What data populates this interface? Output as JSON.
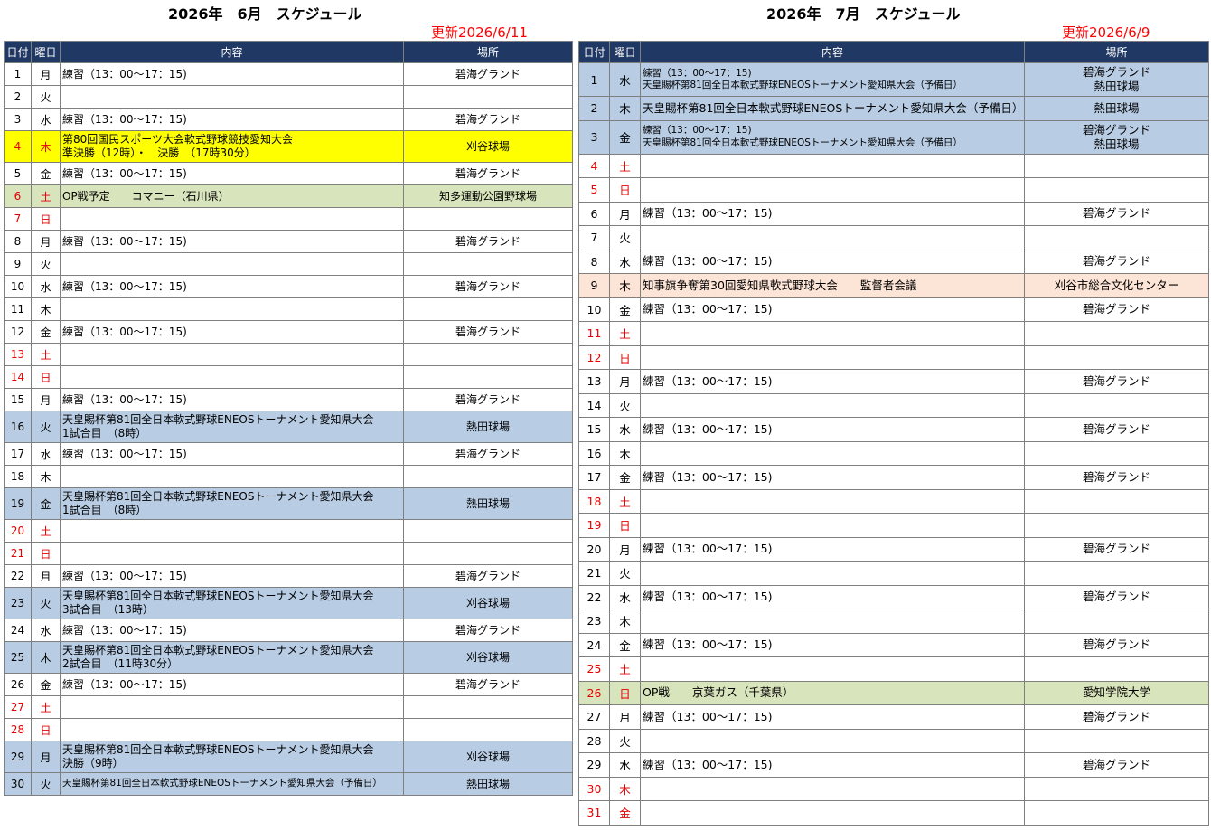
{
  "june": {
    "title": "2026年　6月　スケジュール",
    "updated": "更新2026/6/11",
    "headers": {
      "day": "日付",
      "weekday": "曜日",
      "content": "内容",
      "place": "場所"
    },
    "rows": [
      {
        "day": "1",
        "wd": "月",
        "content": [
          "練習（13：00～17：15)"
        ],
        "place": [
          "碧海グランド"
        ]
      },
      {
        "day": "2",
        "wd": "火",
        "content": [],
        "place": []
      },
      {
        "day": "3",
        "wd": "水",
        "content": [
          "練習（13：00～17：15)"
        ],
        "place": [
          "碧海グランド"
        ]
      },
      {
        "day": "4",
        "wd": "木",
        "content": [
          "第80回国民スポーツ大会軟式野球競技愛知大会",
          "準決勝（12時）・　決勝　（17時30分）"
        ],
        "place": [
          "刈谷球場"
        ],
        "bg": "yellow",
        "red": true
      },
      {
        "day": "5",
        "wd": "金",
        "content": [
          "練習（13：00～17：15)"
        ],
        "place": [
          "碧海グランド"
        ]
      },
      {
        "day": "6",
        "wd": "土",
        "content": [
          "OP戦予定　　コマニー（石川県）"
        ],
        "place": [
          "知多運動公園野球場"
        ],
        "bg": "green",
        "red": true
      },
      {
        "day": "7",
        "wd": "日",
        "content": [],
        "place": [],
        "red": true
      },
      {
        "day": "8",
        "wd": "月",
        "content": [
          "練習（13：00～17：15)"
        ],
        "place": [
          "碧海グランド"
        ]
      },
      {
        "day": "9",
        "wd": "火",
        "content": [],
        "place": []
      },
      {
        "day": "10",
        "wd": "水",
        "content": [
          "練習（13：00～17：15)"
        ],
        "place": [
          "碧海グランド"
        ]
      },
      {
        "day": "11",
        "wd": "木",
        "content": [],
        "place": []
      },
      {
        "day": "12",
        "wd": "金",
        "content": [
          "練習（13：00～17：15)"
        ],
        "place": [
          "碧海グランド"
        ]
      },
      {
        "day": "13",
        "wd": "土",
        "content": [],
        "place": [],
        "red": true
      },
      {
        "day": "14",
        "wd": "日",
        "content": [],
        "place": [],
        "red": true
      },
      {
        "day": "15",
        "wd": "月",
        "content": [
          "練習（13：00～17：15)"
        ],
        "place": [
          "碧海グランド"
        ]
      },
      {
        "day": "16",
        "wd": "火",
        "content": [
          "天皇賜杯第81回全日本軟式野球ENEOSトーナメント愛知県大会",
          "1試合目　（8時）"
        ],
        "place": [
          "熱田球場"
        ],
        "bg": "blue"
      },
      {
        "day": "17",
        "wd": "水",
        "content": [
          "練習（13：00～17：15)"
        ],
        "place": [
          "碧海グランド"
        ]
      },
      {
        "day": "18",
        "wd": "木",
        "content": [],
        "place": []
      },
      {
        "day": "19",
        "wd": "金",
        "content": [
          "天皇賜杯第81回全日本軟式野球ENEOSトーナメント愛知県大会",
          "1試合目　（8時）"
        ],
        "place": [
          "熱田球場"
        ],
        "bg": "blue"
      },
      {
        "day": "20",
        "wd": "土",
        "content": [],
        "place": [],
        "red": true
      },
      {
        "day": "21",
        "wd": "日",
        "content": [],
        "place": [],
        "red": true
      },
      {
        "day": "22",
        "wd": "月",
        "content": [
          "練習（13：00～17：15)"
        ],
        "place": [
          "碧海グランド"
        ]
      },
      {
        "day": "23",
        "wd": "火",
        "content": [
          "天皇賜杯第81回全日本軟式野球ENEOSトーナメント愛知県大会",
          "3試合目　（13時）"
        ],
        "place": [
          "刈谷球場"
        ],
        "bg": "blue"
      },
      {
        "day": "24",
        "wd": "水",
        "content": [
          "練習（13：00～17：15)"
        ],
        "place": [
          "碧海グランド"
        ]
      },
      {
        "day": "25",
        "wd": "木",
        "content": [
          "天皇賜杯第81回全日本軟式野球ENEOSトーナメント愛知県大会",
          "2試合目　（11時30分）"
        ],
        "place": [
          "刈谷球場"
        ],
        "bg": "blue"
      },
      {
        "day": "26",
        "wd": "金",
        "content": [
          "練習（13：00～17：15)"
        ],
        "place": [
          "碧海グランド"
        ]
      },
      {
        "day": "27",
        "wd": "土",
        "content": [],
        "place": [],
        "red": true
      },
      {
        "day": "28",
        "wd": "日",
        "content": [],
        "place": [],
        "red": true
      },
      {
        "day": "29",
        "wd": "月",
        "content": [
          "天皇賜杯第81回全日本軟式野球ENEOSトーナメント愛知県大会",
          "決勝（9時）"
        ],
        "place": [
          "刈谷球場"
        ],
        "bg": "blue"
      },
      {
        "day": "30",
        "wd": "火",
        "content": [
          "天皇賜杯第81回全日本軟式野球ENEOSトーナメント愛知県大会（予備日）"
        ],
        "place": [
          "熱田球場"
        ],
        "bg": "blue",
        "small": true
      }
    ]
  },
  "july": {
    "title": "2026年　7月　スケジュール",
    "updated": "更新2026/6/9",
    "headers": {
      "day": "日付",
      "weekday": "曜日",
      "content": "内容",
      "place": "場所"
    },
    "rows": [
      {
        "day": "1",
        "wd": "水",
        "content": [
          "練習（13：00～17：15)",
          "天皇賜杯第81回全日本軟式野球ENEOSトーナメント愛知県大会（予備日）"
        ],
        "place": [
          "碧海グランド",
          "熱田球場"
        ],
        "bg": "blue",
        "small": true
      },
      {
        "day": "2",
        "wd": "木",
        "content": [
          "天皇賜杯第81回全日本軟式野球ENEOSトーナメント愛知県大会（予備日）"
        ],
        "place": [
          "熱田球場"
        ],
        "bg": "blue"
      },
      {
        "day": "3",
        "wd": "金",
        "content": [
          "練習（13：00～17：15)",
          "天皇賜杯第81回全日本軟式野球ENEOSトーナメント愛知県大会（予備日）"
        ],
        "place": [
          "碧海グランド",
          "熱田球場"
        ],
        "bg": "blue",
        "small": true
      },
      {
        "day": "4",
        "wd": "土",
        "content": [],
        "place": [],
        "red": true
      },
      {
        "day": "5",
        "wd": "日",
        "content": [],
        "place": [],
        "red": true
      },
      {
        "day": "6",
        "wd": "月",
        "content": [
          "練習（13：00～17：15)"
        ],
        "place": [
          "碧海グランド"
        ]
      },
      {
        "day": "7",
        "wd": "火",
        "content": [],
        "place": []
      },
      {
        "day": "8",
        "wd": "水",
        "content": [
          "練習（13：00～17：15)"
        ],
        "place": [
          "碧海グランド"
        ]
      },
      {
        "day": "9",
        "wd": "木",
        "content": [
          "知事旗争奪第30回愛知県軟式野球大会　　監督者会議"
        ],
        "place": [
          "刈谷市総合文化センター"
        ],
        "bg": "peach"
      },
      {
        "day": "10",
        "wd": "金",
        "content": [
          "練習（13：00～17：15)"
        ],
        "place": [
          "碧海グランド"
        ]
      },
      {
        "day": "11",
        "wd": "土",
        "content": [],
        "place": [],
        "red": true
      },
      {
        "day": "12",
        "wd": "日",
        "content": [],
        "place": [],
        "red": true
      },
      {
        "day": "13",
        "wd": "月",
        "content": [
          "練習（13：00～17：15)"
        ],
        "place": [
          "碧海グランド"
        ]
      },
      {
        "day": "14",
        "wd": "火",
        "content": [],
        "place": []
      },
      {
        "day": "15",
        "wd": "水",
        "content": [
          "練習（13：00～17：15)"
        ],
        "place": [
          "碧海グランド"
        ]
      },
      {
        "day": "16",
        "wd": "木",
        "content": [],
        "place": []
      },
      {
        "day": "17",
        "wd": "金",
        "content": [
          "練習（13：00～17：15)"
        ],
        "place": [
          "碧海グランド"
        ]
      },
      {
        "day": "18",
        "wd": "土",
        "content": [],
        "place": [],
        "red": true
      },
      {
        "day": "19",
        "wd": "日",
        "content": [],
        "place": [],
        "red": true
      },
      {
        "day": "20",
        "wd": "月",
        "content": [
          "練習（13：00～17：15)"
        ],
        "place": [
          "碧海グランド"
        ]
      },
      {
        "day": "21",
        "wd": "火",
        "content": [],
        "place": []
      },
      {
        "day": "22",
        "wd": "水",
        "content": [
          "練習（13：00～17：15)"
        ],
        "place": [
          "碧海グランド"
        ]
      },
      {
        "day": "23",
        "wd": "木",
        "content": [],
        "place": []
      },
      {
        "day": "24",
        "wd": "金",
        "content": [
          "練習（13：00～17：15)"
        ],
        "place": [
          "碧海グランド"
        ]
      },
      {
        "day": "25",
        "wd": "土",
        "content": [],
        "place": [],
        "red": true
      },
      {
        "day": "26",
        "wd": "日",
        "content": [
          "OP戦　　京葉ガス（千葉県）"
        ],
        "place": [
          "愛知学院大学"
        ],
        "bg": "green",
        "red": true
      },
      {
        "day": "27",
        "wd": "月",
        "content": [
          "練習（13：00～17：15)"
        ],
        "place": [
          "碧海グランド"
        ]
      },
      {
        "day": "28",
        "wd": "火",
        "content": [],
        "place": []
      },
      {
        "day": "29",
        "wd": "水",
        "content": [
          "練習（13：00～17：15)"
        ],
        "place": [
          "碧海グランド"
        ]
      },
      {
        "day": "30",
        "wd": "木",
        "content": [],
        "place": [],
        "red": true
      },
      {
        "day": "31",
        "wd": "金",
        "content": [],
        "place": [],
        "red": true
      }
    ]
  }
}
